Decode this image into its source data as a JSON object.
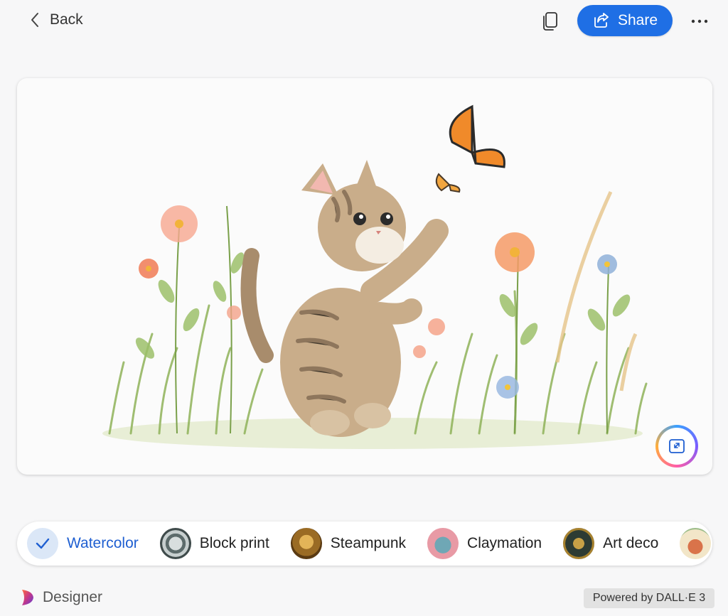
{
  "topbar": {
    "back_label": "Back",
    "share_label": "Share"
  },
  "icons": {
    "back": "chevron-left-icon",
    "copy": "copy-icon",
    "share": "share-icon",
    "more": "more-horizontal-icon",
    "expand": "expand-icon",
    "check": "checkmark-icon",
    "brand": "designer-logo"
  },
  "colors": {
    "accent": "#1f6fe5",
    "selected_text": "#1f5fd1"
  },
  "styles": {
    "selected": "Watercolor",
    "items": [
      {
        "label": "Watercolor"
      },
      {
        "label": "Block print"
      },
      {
        "label": "Steampunk"
      },
      {
        "label": "Claymation"
      },
      {
        "label": "Art deco"
      }
    ]
  },
  "footer": {
    "brand_label": "Designer",
    "powered_by": "Powered by DALL·E 3"
  }
}
